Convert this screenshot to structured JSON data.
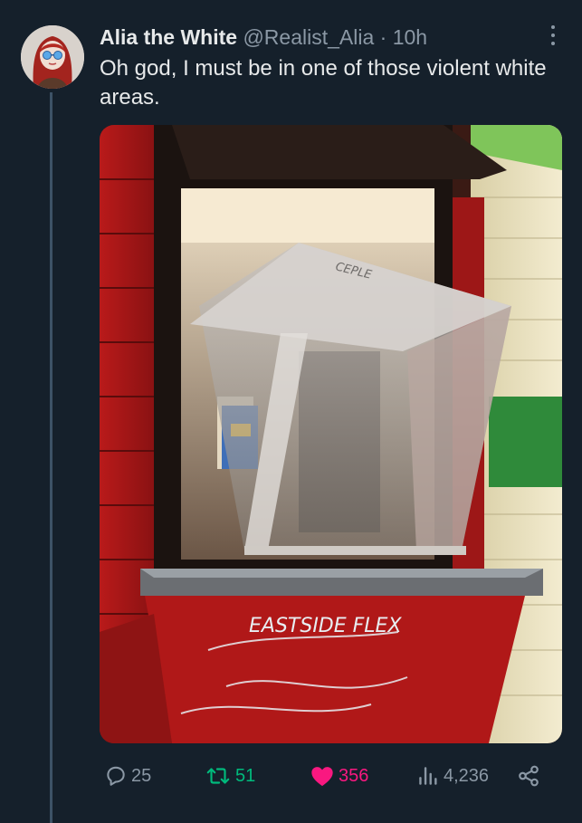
{
  "tweet": {
    "display_name": "Alia the White",
    "handle": "@Realist_Alia",
    "separator": "·",
    "time": "10h",
    "text": "Oh god, I must be in one of those violent white areas."
  },
  "media": {
    "graffiti_top": "CEPLE",
    "graffiti_bottom": "EASTSIDE FLEX"
  },
  "actions": {
    "replies": "25",
    "reposts": "51",
    "likes": "356",
    "views": "4,236"
  },
  "colors": {
    "background": "#15202b",
    "text": "#e7e9ea",
    "muted": "#8b98a5",
    "repost_green": "#00ba7c",
    "like_pink": "#f91880"
  },
  "icons": [
    "more-options-icon",
    "reply-icon",
    "repost-icon",
    "like-icon",
    "views-icon",
    "share-icon"
  ]
}
